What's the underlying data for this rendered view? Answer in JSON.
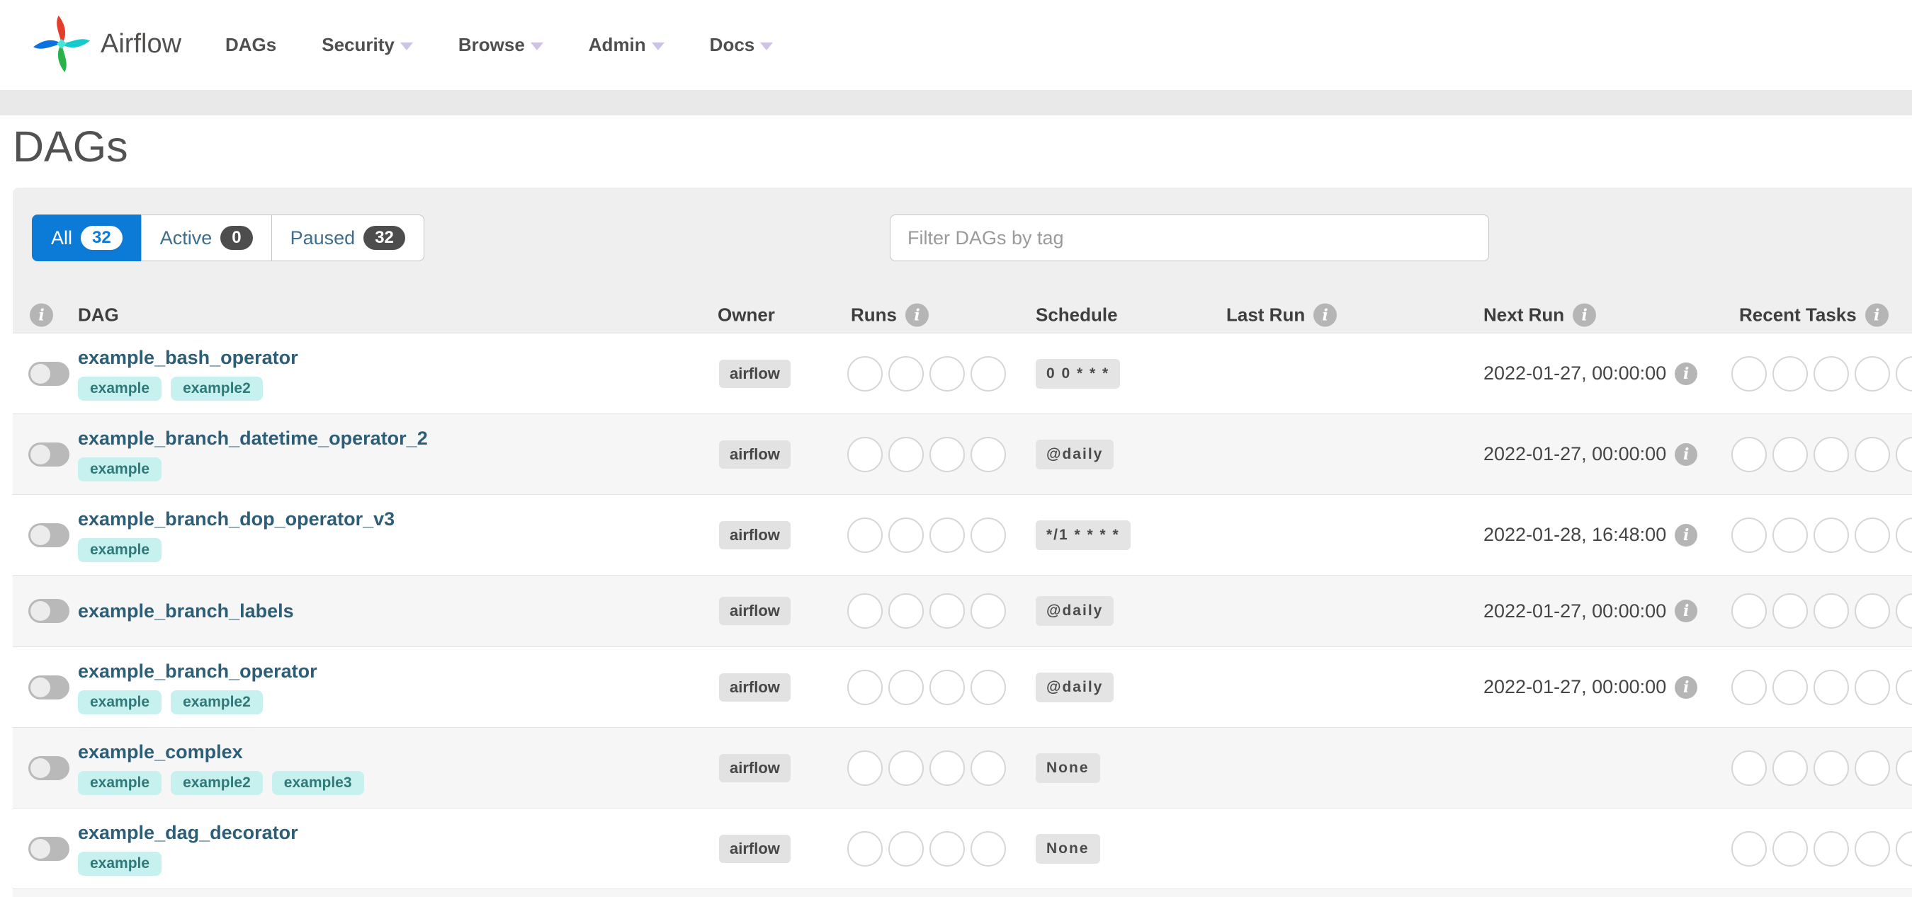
{
  "navbar": {
    "brand": "Airflow",
    "items": [
      {
        "label": "DAGs",
        "caret": false
      },
      {
        "label": "Security",
        "caret": true
      },
      {
        "label": "Browse",
        "caret": true
      },
      {
        "label": "Admin",
        "caret": true
      },
      {
        "label": "Docs",
        "caret": true
      }
    ]
  },
  "page": {
    "title": "DAGs"
  },
  "tabs": [
    {
      "label": "All",
      "count": "32",
      "active": true
    },
    {
      "label": "Active",
      "count": "0",
      "active": false
    },
    {
      "label": "Paused",
      "count": "32",
      "active": false
    }
  ],
  "filter": {
    "placeholder": "Filter DAGs by tag"
  },
  "table": {
    "columns": {
      "dag": "DAG",
      "owner": "Owner",
      "runs": "Runs",
      "schedule": "Schedule",
      "last_run": "Last Run",
      "next_run": "Next Run",
      "recent_tasks": "Recent Tasks"
    },
    "runs_slots": 4,
    "recent_task_slots": 5
  },
  "rows": [
    {
      "name": "example_bash_operator",
      "tags": [
        "example",
        "example2"
      ],
      "owner": "airflow",
      "schedule": "0 0 * * *",
      "last_run": "",
      "next_run": "2022-01-27, 00:00:00"
    },
    {
      "name": "example_branch_datetime_operator_2",
      "tags": [
        "example"
      ],
      "owner": "airflow",
      "schedule": "@daily",
      "last_run": "",
      "next_run": "2022-01-27, 00:00:00"
    },
    {
      "name": "example_branch_dop_operator_v3",
      "tags": [
        "example"
      ],
      "owner": "airflow",
      "schedule": "*/1 * * * *",
      "last_run": "",
      "next_run": "2022-01-28, 16:48:00"
    },
    {
      "name": "example_branch_labels",
      "tags": [],
      "owner": "airflow",
      "schedule": "@daily",
      "last_run": "",
      "next_run": "2022-01-27, 00:00:00"
    },
    {
      "name": "example_branch_operator",
      "tags": [
        "example",
        "example2"
      ],
      "owner": "airflow",
      "schedule": "@daily",
      "last_run": "",
      "next_run": "2022-01-27, 00:00:00"
    },
    {
      "name": "example_complex",
      "tags": [
        "example",
        "example2",
        "example3"
      ],
      "owner": "airflow",
      "schedule": "None",
      "last_run": "",
      "next_run": ""
    },
    {
      "name": "example_dag_decorator",
      "tags": [
        "example"
      ],
      "owner": "airflow",
      "schedule": "None",
      "last_run": "",
      "next_run": ""
    }
  ],
  "colors": {
    "tab_active_bg": "#0c7bd8",
    "dag_link": "#2d5e78",
    "tag_bg": "#c7f1ef",
    "tag_text": "#30797a",
    "panel_bg": "#efefef",
    "badge_bg": "#e4e4e4",
    "logo_red": "#e43e2b",
    "logo_teal": "#15c9ce",
    "logo_green": "#2ab24a",
    "logo_blue": "#0c71e0"
  }
}
